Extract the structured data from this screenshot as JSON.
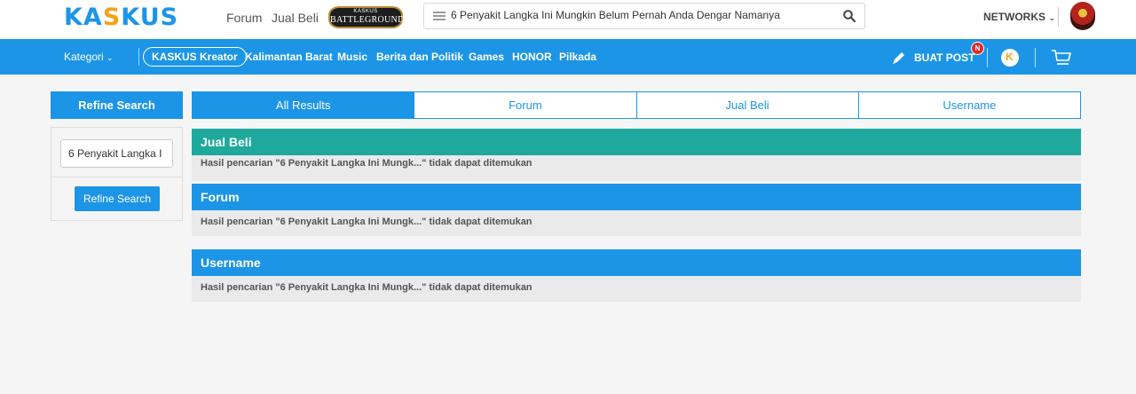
{
  "header": {
    "logo": {
      "part1": "KA",
      "part2": "S",
      "part3": "KUS"
    },
    "links": [
      "Forum",
      "Jual Beli"
    ],
    "battleground": {
      "line1": "KASKUS",
      "line2": "BATTLEGROUND"
    },
    "search_query": "6 Penyakit Langka Ini Mungkin Belum Pernah Anda Dengar Namanya",
    "networks_label": "NETWORKS"
  },
  "nav": {
    "kategori": "Kategori",
    "kreator": "KASKUS Kreator",
    "items": [
      "Kalimantan Barat",
      "Music",
      "Berita dan Politik",
      "Games",
      "HONOR",
      "Pilkada"
    ],
    "buat_post": "BUAT POST",
    "badge": "N",
    "chat_glyph": "K"
  },
  "sidebar": {
    "title": "Refine Search",
    "input_value": "6 Penyakit Langka I",
    "button": "Refine Search"
  },
  "tabs": [
    "All Results",
    "Forum",
    "Jual Beli",
    "Username"
  ],
  "sections": [
    {
      "title": "Jual Beli",
      "color": "#1ea99c",
      "message": "Hasil pencarian \"6 Penyakit Langka Ini Mungk...\" tidak dapat ditemukan"
    },
    {
      "title": "Forum",
      "color": "#1c95e6",
      "message": "Hasil pencarian \"6 Penyakit Langka Ini Mungk...\" tidak dapat ditemukan"
    },
    {
      "title": "Username",
      "color": "#1c95e6",
      "message": "Hasil pencarian \"6 Penyakit Langka Ini Mungk...\" tidak dapat ditemukan"
    }
  ],
  "colors": {
    "primary": "#1c95e6",
    "accent": "#f6a21b",
    "teal": "#1ea99c",
    "badge": "#e5282a"
  }
}
